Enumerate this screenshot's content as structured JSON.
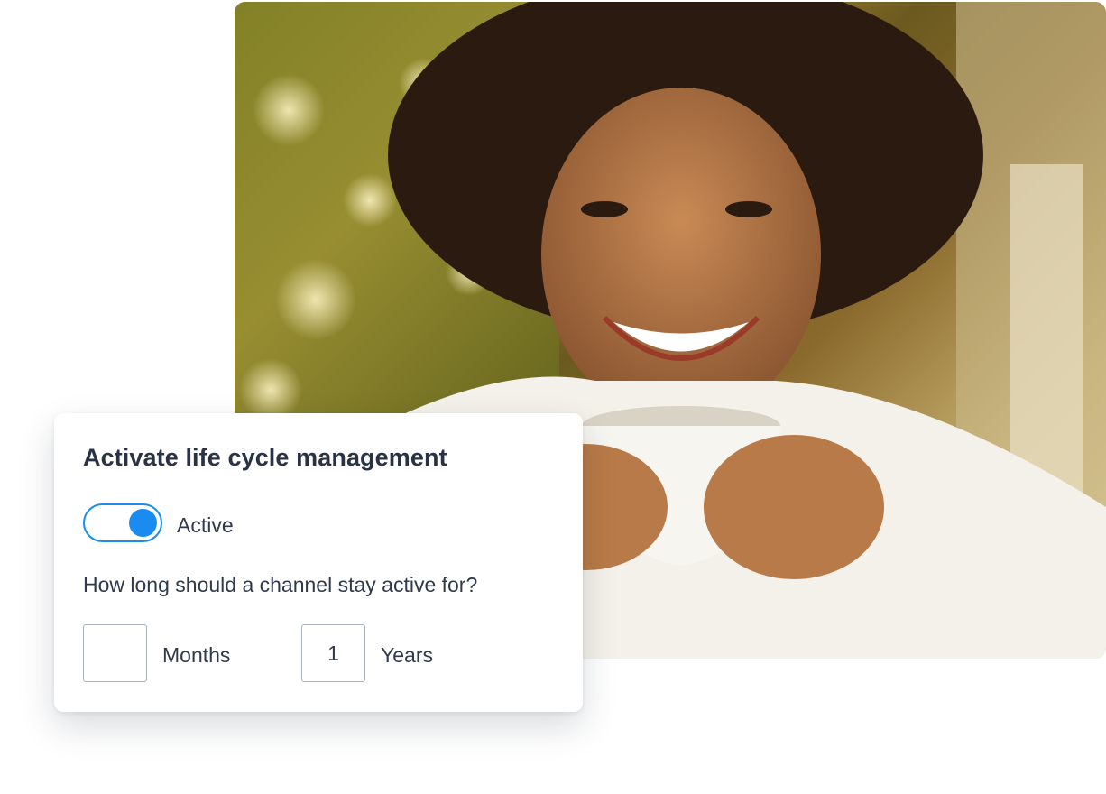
{
  "card": {
    "title": "Activate life cycle management",
    "toggle": {
      "state": "on",
      "label": "Active"
    },
    "question": "How long should a channel stay active for?",
    "fields": [
      {
        "value": "",
        "label": "Months"
      },
      {
        "value": "1",
        "label": "Years"
      }
    ]
  },
  "colors": {
    "accent": "#1a8cf0",
    "title_text": "#2a3345",
    "body_text": "#2f3a4c",
    "input_border": "#a9b1bd"
  }
}
